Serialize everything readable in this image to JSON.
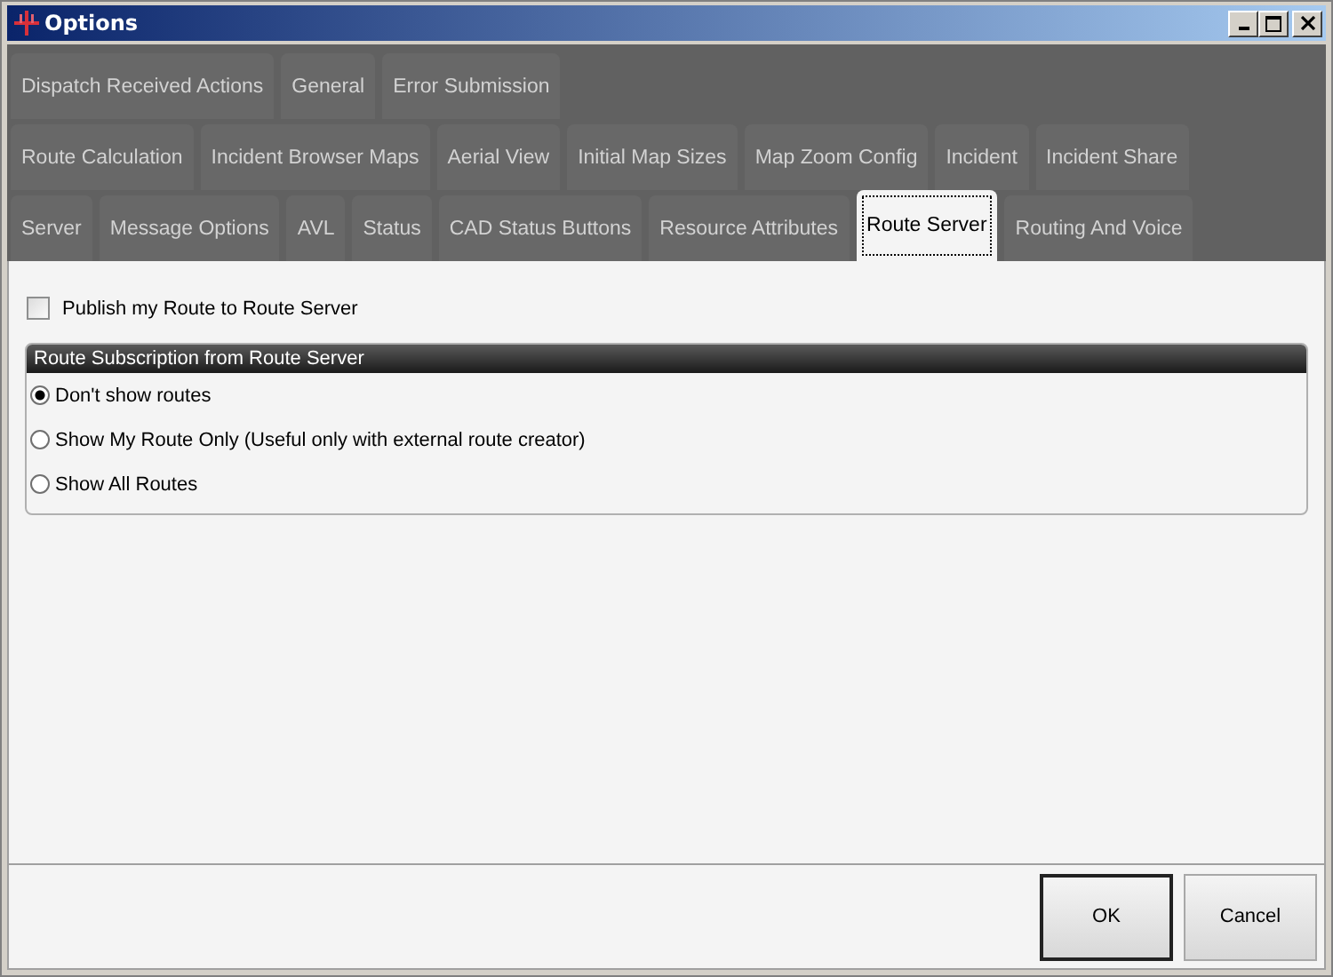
{
  "window": {
    "title": "Options"
  },
  "tab_rows": [
    [
      {
        "label": "Dispatch Received Actions",
        "selected": false
      },
      {
        "label": "General",
        "selected": false
      },
      {
        "label": "Error Submission",
        "selected": false
      }
    ],
    [
      {
        "label": "Route Calculation",
        "selected": false
      },
      {
        "label": "Incident Browser Maps",
        "selected": false
      },
      {
        "label": "Aerial View",
        "selected": false
      },
      {
        "label": "Initial Map Sizes",
        "selected": false
      },
      {
        "label": "Map Zoom Config",
        "selected": false
      },
      {
        "label": "Incident",
        "selected": false
      },
      {
        "label": "Incident Share",
        "selected": false
      }
    ],
    [
      {
        "label": "Server",
        "selected": false
      },
      {
        "label": "Message Options",
        "selected": false
      },
      {
        "label": "AVL",
        "selected": false
      },
      {
        "label": "Status",
        "selected": false
      },
      {
        "label": "CAD Status Buttons",
        "selected": false
      },
      {
        "label": "Resource Attributes",
        "selected": false
      },
      {
        "label": "Route Server",
        "selected": true
      },
      {
        "label": "Routing And Voice",
        "selected": false
      }
    ]
  ],
  "publish_checkbox": {
    "label": "Publish my Route to Route Server",
    "checked": false
  },
  "subscription_group": {
    "title": "Route Subscription from Route Server",
    "options": [
      {
        "label": "Don't show routes",
        "selected": true
      },
      {
        "label": "Show My Route Only (Useful only with external route creator)",
        "selected": false
      },
      {
        "label": "Show All Routes",
        "selected": false
      }
    ]
  },
  "buttons": [
    {
      "label": "OK",
      "default": true
    },
    {
      "label": "Cancel",
      "default": false
    }
  ]
}
